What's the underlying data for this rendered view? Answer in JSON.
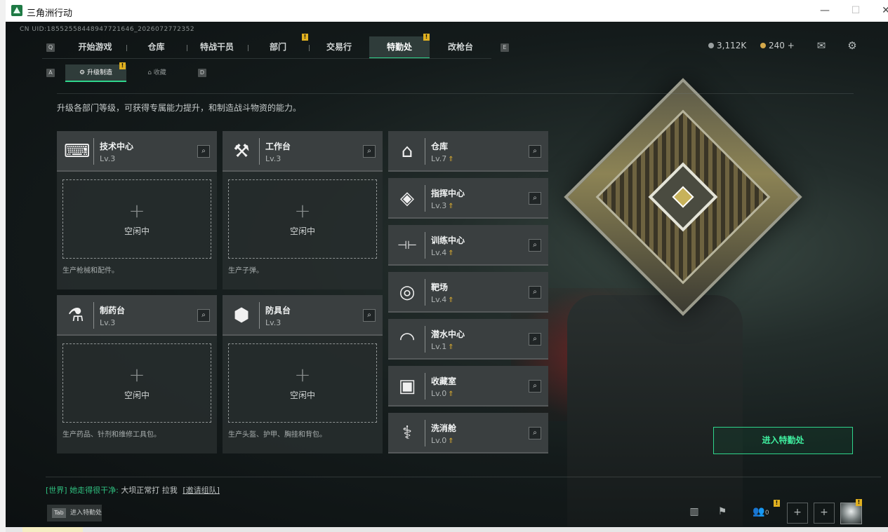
{
  "window": {
    "title": "三角洲行动",
    "minimize": "—",
    "maximize": "☐",
    "close": "✕"
  },
  "header": {
    "uid": "CN UID:18552558448947721646_2026072772352",
    "nav_key_left": "Q",
    "nav_key_right": "E",
    "tabs": [
      {
        "label": "开始游戏"
      },
      {
        "label": "仓库"
      },
      {
        "label": "特战干员"
      },
      {
        "label": "部门",
        "badge": "!"
      },
      {
        "label": "交易行"
      },
      {
        "label": "特勤处",
        "badge": "!",
        "active": true
      },
      {
        "label": "改枪台"
      }
    ],
    "subnav": {
      "key_left": "A",
      "key_right": "D",
      "tabs": [
        {
          "label": "升级制造",
          "badge": "!",
          "active": true
        },
        {
          "label": "收藏"
        }
      ]
    },
    "currency": [
      {
        "value": "3,112K",
        "color": "#9aa0a0"
      },
      {
        "value": "240",
        "color": "#d4a84a",
        "extra": "+"
      }
    ],
    "icons": [
      "mail-icon",
      "gear-icon"
    ]
  },
  "description": "升级各部门等级，可获得专属能力提升，和制造战斗物资的能力。",
  "workshops": [
    {
      "name": "技术中心",
      "level": "Lv.3",
      "icon": "tech-center-icon",
      "glyph": "⌨",
      "idle": "空闲中",
      "plus": "+",
      "footer": "生产枪械和配件。"
    },
    {
      "name": "工作台",
      "level": "Lv.3",
      "icon": "workbench-icon",
      "glyph": "⚒",
      "idle": "空闲中",
      "plus": "+",
      "footer": "生产子弹。"
    },
    {
      "name": "制药台",
      "level": "Lv.3",
      "icon": "pharmacy-icon",
      "glyph": "⚗",
      "idle": "空闲中",
      "plus": "+",
      "footer": "生产药品、针剂和维修工具包。"
    },
    {
      "name": "防具台",
      "level": "Lv.3",
      "icon": "armor-bench-icon",
      "glyph": "⬢",
      "idle": "空闲中",
      "plus": "+",
      "footer": "生产头盔、护甲、胸挂和背包。"
    }
  ],
  "facilities": [
    {
      "name": "仓库",
      "level": "Lv.7",
      "icon": "warehouse-icon",
      "glyph": "⌂",
      "up": "⇑"
    },
    {
      "name": "指挥中心",
      "level": "Lv.3",
      "icon": "command-center-icon",
      "glyph": "◈",
      "up": "⇑"
    },
    {
      "name": "训练中心",
      "level": "Lv.4",
      "icon": "training-center-icon",
      "glyph": "⊣⊢",
      "up": "⇑"
    },
    {
      "name": "靶场",
      "level": "Lv.4",
      "icon": "shooting-range-icon",
      "glyph": "◎",
      "up": "⇑"
    },
    {
      "name": "潜水中心",
      "level": "Lv.1",
      "icon": "diving-center-icon",
      "glyph": "◠",
      "up": "⇑"
    },
    {
      "name": "收藏室",
      "level": "Lv.0",
      "icon": "collection-room-icon",
      "glyph": "▣",
      "up": "⇑"
    },
    {
      "name": "洗消舱",
      "level": "Lv.0",
      "icon": "decon-chamber-icon",
      "glyph": "⚕",
      "up": "⇑"
    }
  ],
  "zoom_glyph": "⌕",
  "enter_button": "进入特勤处",
  "chat": {
    "channel": "[世界]",
    "sender": "她走得很干净:",
    "message": "大坝正常打 拉我",
    "link": "[邀请组队]"
  },
  "tab_hint": {
    "key": "Tab",
    "label": "进入特勤处"
  },
  "bottom_bar": {
    "friends_count": "0",
    "friends_badge": "!",
    "avatar_badge": "!"
  }
}
